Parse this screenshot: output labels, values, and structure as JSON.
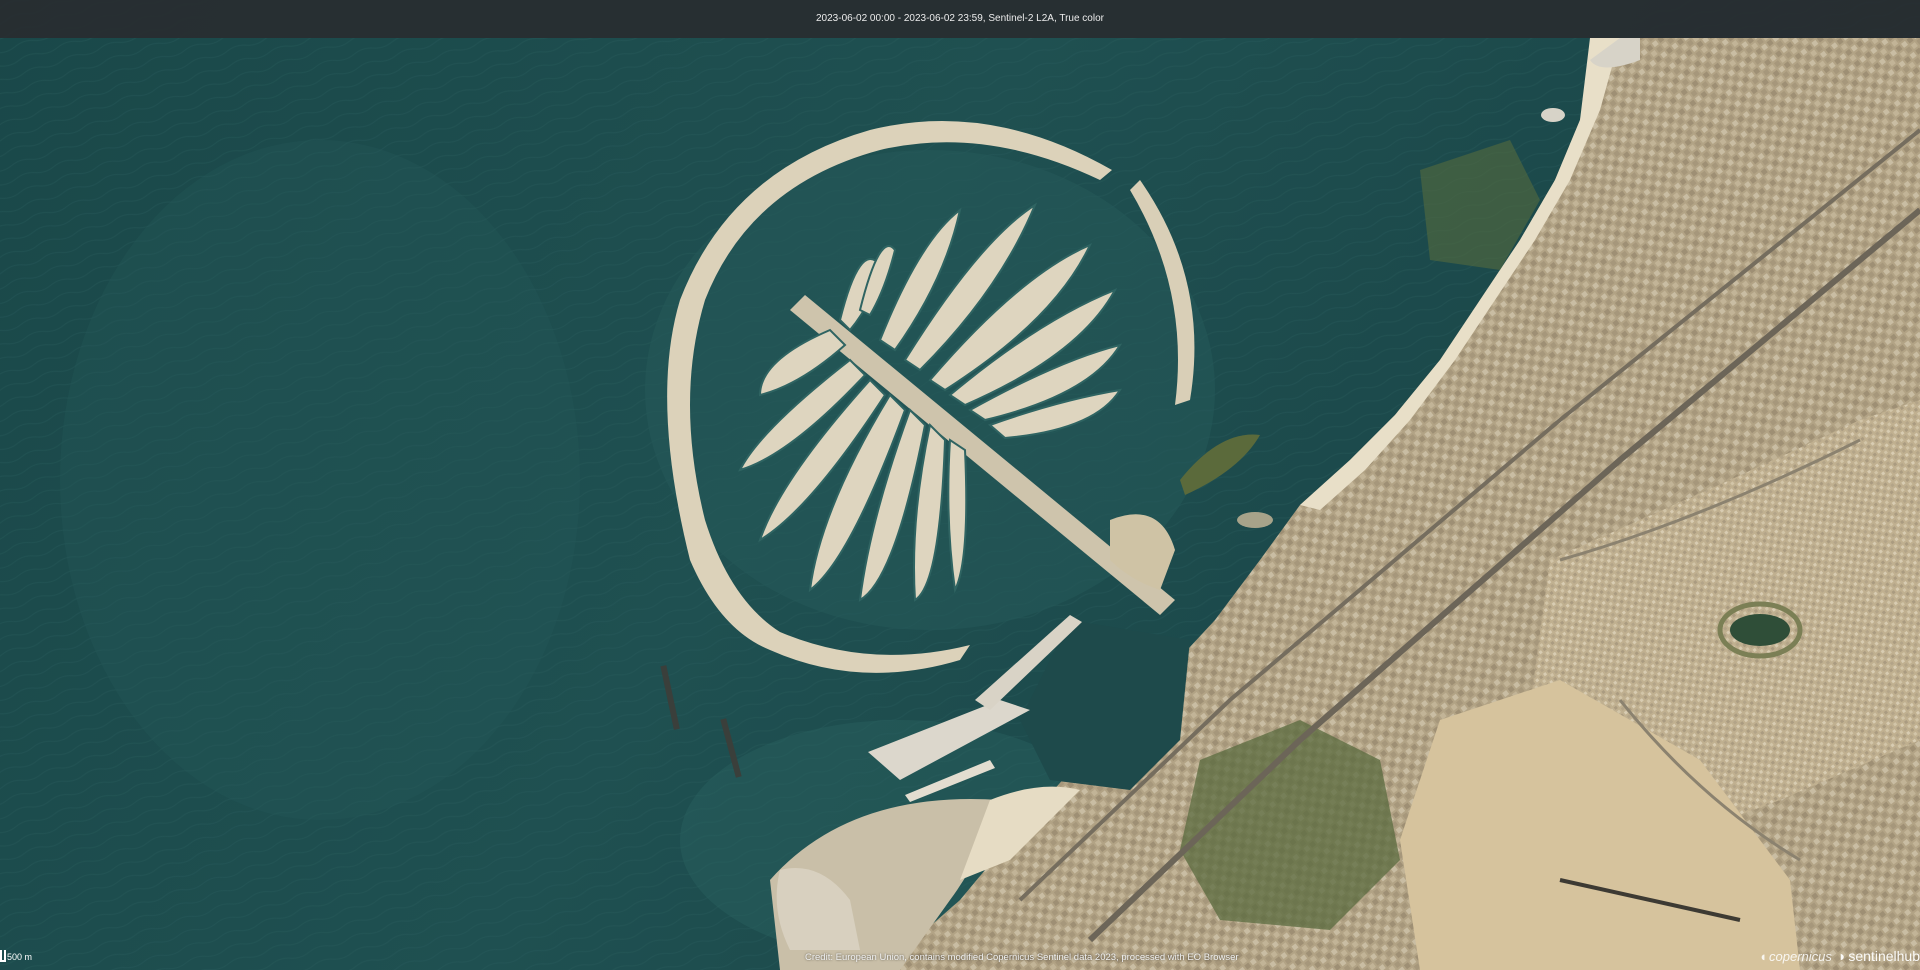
{
  "header": {
    "title": "2023-06-02 00:00 - 2023-06-02 23:59, Sentinel-2 L2A, True color"
  },
  "scale": {
    "label": "500 m"
  },
  "footer": {
    "credits": "Credit: European Union, contains modified Copernicus Sentinel data 2023, processed with EO Browser",
    "logo_copernicus": "copernicus",
    "logo_sentinelhub": "sentinelhub"
  },
  "map": {
    "place": "Palm Jumeirah, Dubai",
    "icons": [
      "copernicus-logo-icon",
      "sentinelhub-logo-icon"
    ],
    "colors": {
      "sea": "#1d4c4d",
      "sea_deep": "#16403f",
      "shallow": "#2c6a66",
      "sand": "#d9cdb2",
      "beach": "#ebe2cd",
      "city": "#a99a7f",
      "vegetation": "#4e6a3a",
      "header": "#282c30"
    }
  }
}
